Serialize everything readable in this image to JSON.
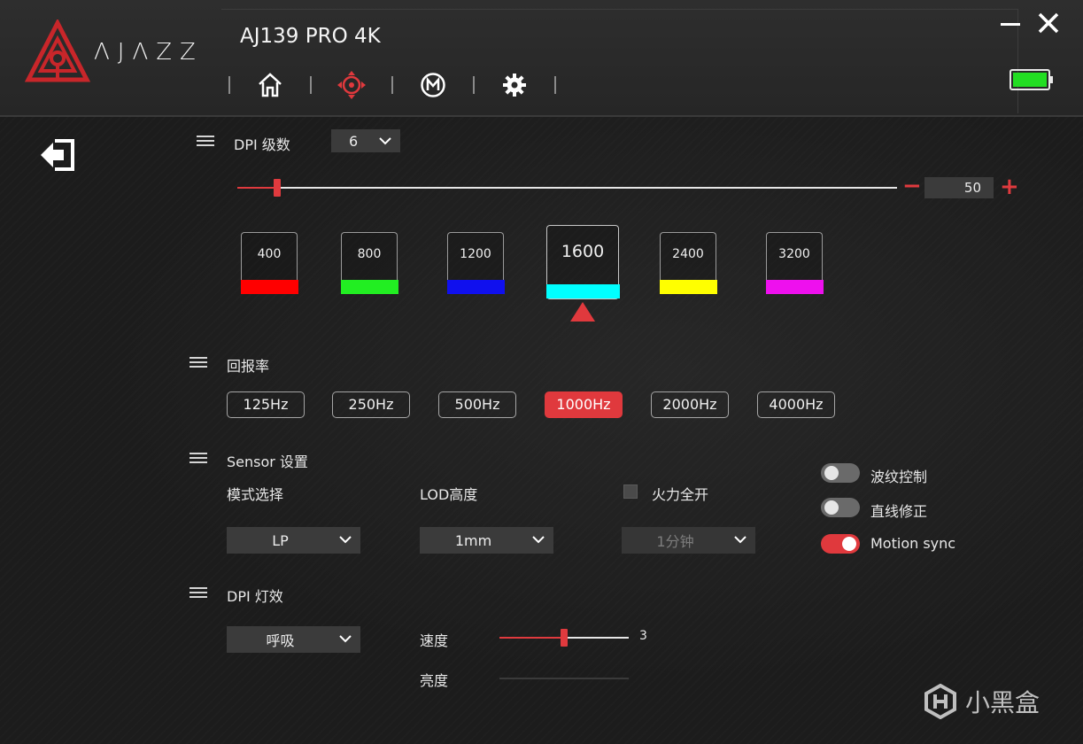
{
  "app": {
    "brand": "ΛJΛZZ",
    "device_name": "AJ139 PRO 4K",
    "nav": [
      "home-icon",
      "crosshair-icon",
      "macro-icon",
      "gear-icon"
    ],
    "active_nav": "crosshair-icon",
    "battery": {
      "level": 1.0,
      "color": "#22dd22"
    }
  },
  "dpi": {
    "title": "DPI 级数",
    "levels_value": "6",
    "slider_value": "50",
    "slider_fraction": 0.06,
    "minus": "−",
    "plus": "+",
    "cards": [
      {
        "value": "400",
        "color": "#ff0000"
      },
      {
        "value": "800",
        "color": "#22ee22"
      },
      {
        "value": "1200",
        "color": "#1010ee"
      },
      {
        "value": "1600",
        "color": "#00ffff",
        "active": true
      },
      {
        "value": "2400",
        "color": "#ffff00"
      },
      {
        "value": "3200",
        "color": "#ee10ee"
      }
    ]
  },
  "polling": {
    "title": "回报率",
    "rates": [
      "125Hz",
      "250Hz",
      "500Hz",
      "1000Hz",
      "2000Hz",
      "4000Hz"
    ],
    "active": "1000Hz"
  },
  "sensor": {
    "title": "Sensor 设置",
    "mode_label": "模式选择",
    "mode_value": "LP",
    "lod_label": "LOD高度",
    "lod_value": "1mm",
    "fire_label": "火力全开",
    "fire_checked": false,
    "fire_value": "1分钟",
    "ripple_label": "波纹控制",
    "ripple_on": false,
    "angle_label": "直线修正",
    "angle_on": false,
    "motion_label": "Motion sync",
    "motion_on": true
  },
  "light": {
    "title": "DPI 灯效",
    "effect_value": "呼吸",
    "speed_label": "速度",
    "speed_value": "3",
    "speed_fraction": 0.5,
    "brightness_label": "亮度"
  },
  "watermark": "小黑盒",
  "accent_color": "#e0393d"
}
